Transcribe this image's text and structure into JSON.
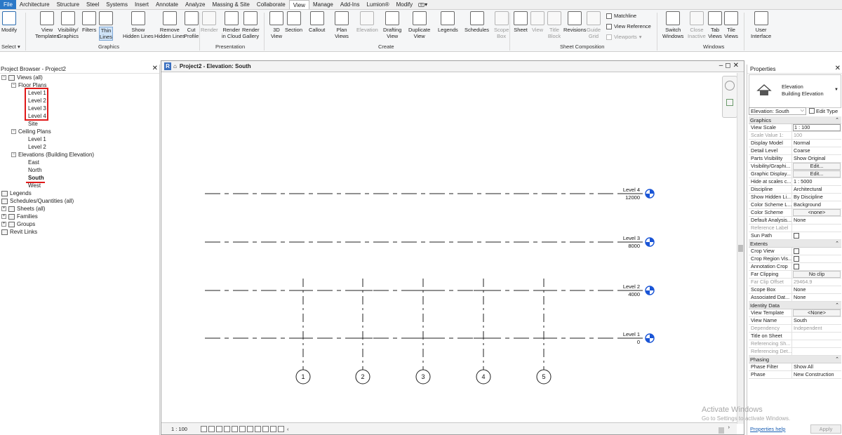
{
  "ribbon": {
    "tabs": [
      "File",
      "Architecture",
      "Structure",
      "Steel",
      "Systems",
      "Insert",
      "Annotate",
      "Analyze",
      "Massing & Site",
      "Collaborate",
      "View",
      "Manage",
      "Add-Ins",
      "Lumion®",
      "Modify"
    ],
    "active_tab": "View",
    "buttons": [
      {
        "label": "Modify"
      },
      {
        "label": "View\nTemplates"
      },
      {
        "label": "Visibility/\nGraphics"
      },
      {
        "label": "Filters"
      },
      {
        "label": "Thin\nLines"
      },
      {
        "label": "Show\nHidden Lines"
      },
      {
        "label": "Remove\nHidden Lines"
      },
      {
        "label": "Cut\nProfile"
      },
      {
        "label": "Render"
      },
      {
        "label": "Render\nin Cloud"
      },
      {
        "label": "Render\nGallery"
      },
      {
        "label": "3D\nView"
      },
      {
        "label": "Section"
      },
      {
        "label": "Callout"
      },
      {
        "label": "Plan\nViews"
      },
      {
        "label": "Elevation"
      },
      {
        "label": "Drafting\nView"
      },
      {
        "label": "Duplicate\nView"
      },
      {
        "label": "Legends"
      },
      {
        "label": "Schedules"
      },
      {
        "label": "Scope\nBox"
      },
      {
        "label": "Sheet"
      },
      {
        "label": "View"
      },
      {
        "label": "Title\nBlock"
      },
      {
        "label": "Revisions"
      },
      {
        "label": "Guide\nGrid"
      },
      {
        "label": "Switch\nWindows"
      },
      {
        "label": "Close\nInactive"
      },
      {
        "label": "Tab\nViews"
      },
      {
        "label": "Tile\nViews"
      },
      {
        "label": "User\nInterface"
      }
    ],
    "small_items": {
      "matchline": "Matchline",
      "view_reference": "View Reference",
      "viewports": "Viewports"
    },
    "panels": {
      "select": "Select",
      "graphics": "Graphics",
      "presentation": "Presentation",
      "create": "Create",
      "sheet_composition": "Sheet Composition",
      "windows": "Windows"
    }
  },
  "project_browser": {
    "title": "Project Browser - Project2",
    "tree": {
      "views_all": "Views (all)",
      "floor_plans": "Floor Plans",
      "floor_plan_items": [
        "Level 1",
        "Level 2",
        "Level 3",
        "Level 4",
        "Site"
      ],
      "ceiling_plans": "Ceiling Plans",
      "ceiling_items": [
        "Level 1",
        "Level 2"
      ],
      "elevations": "Elevations (Building Elevation)",
      "elevation_items": [
        "East",
        "North",
        "South",
        "West"
      ],
      "others": [
        "Legends",
        "Schedules/Quantities (all)",
        "Sheets (all)",
        "Families",
        "Groups",
        "Revit Links"
      ]
    }
  },
  "view": {
    "title": "Project2 - Elevation: South",
    "scale": "1 : 100",
    "levels": [
      {
        "name": "Level 4",
        "elevation": "12000"
      },
      {
        "name": "Level 3",
        "elevation": "8000"
      },
      {
        "name": "Level 2",
        "elevation": "4000"
      },
      {
        "name": "Level 1",
        "elevation": "0"
      }
    ],
    "grids": [
      "1",
      "2",
      "3",
      "4",
      "5"
    ]
  },
  "properties": {
    "title": "Properties",
    "type_family": "Elevation",
    "type_name": "Building Elevation",
    "instance": "Elevation: South",
    "edit_type": "Edit Type",
    "sections": [
      {
        "name": "Graphics",
        "rows": [
          {
            "k": "View Scale",
            "v": "1 : 100",
            "style": "boxed"
          },
          {
            "k": "Scale Value    1:",
            "v": "100",
            "style": "dis"
          },
          {
            "k": "Display Model",
            "v": "Normal"
          },
          {
            "k": "Detail Level",
            "v": "Coarse"
          },
          {
            "k": "Parts Visibility",
            "v": "Show Original"
          },
          {
            "k": "Visibility/Graphi...",
            "v": "Edit...",
            "style": "btn"
          },
          {
            "k": "Graphic Display...",
            "v": "Edit...",
            "style": "btn"
          },
          {
            "k": "Hide at scales c...",
            "v": "1 : 5000"
          },
          {
            "k": "Discipline",
            "v": "Architectural"
          },
          {
            "k": "Show Hidden Li...",
            "v": "By Discipline"
          },
          {
            "k": "Color Scheme L...",
            "v": "Background"
          },
          {
            "k": "Color Scheme",
            "v": "<none>",
            "style": "btn"
          },
          {
            "k": "Default Analysis...",
            "v": "None"
          },
          {
            "k": "Reference Label",
            "v": "",
            "style": "dis"
          },
          {
            "k": "Sun Path",
            "v": "",
            "style": "check"
          }
        ]
      },
      {
        "name": "Extents",
        "rows": [
          {
            "k": "Crop View",
            "v": "",
            "style": "check"
          },
          {
            "k": "Crop Region Vis...",
            "v": "",
            "style": "check"
          },
          {
            "k": "Annotation Crop",
            "v": "",
            "style": "check"
          },
          {
            "k": "Far Clipping",
            "v": "No clip",
            "style": "btn"
          },
          {
            "k": "Far Clip Offset",
            "v": "29464.9",
            "style": "dis"
          },
          {
            "k": "Scope Box",
            "v": "None"
          },
          {
            "k": "Associated Dat...",
            "v": "None"
          }
        ]
      },
      {
        "name": "Identity Data",
        "rows": [
          {
            "k": "View Template",
            "v": "<None>",
            "style": "btn"
          },
          {
            "k": "View Name",
            "v": "South"
          },
          {
            "k": "Dependency",
            "v": "Independent",
            "style": "dis"
          },
          {
            "k": "Title on Sheet",
            "v": ""
          },
          {
            "k": "Referencing Sh...",
            "v": "",
            "style": "dis"
          },
          {
            "k": "Referencing Det...",
            "v": "",
            "style": "dis"
          }
        ]
      },
      {
        "name": "Phasing",
        "rows": [
          {
            "k": "Phase Filter",
            "v": "Show All"
          },
          {
            "k": "Phase",
            "v": "New Construction"
          }
        ]
      }
    ],
    "help": "Properties help",
    "apply": "Apply"
  },
  "watermark": {
    "line1": "Activate Windows",
    "line2": "Go to Settings to activate Windows."
  },
  "colors": {
    "accent": "#2b78c7",
    "highlight": "#e01818",
    "level_head": "#1a55d6"
  }
}
